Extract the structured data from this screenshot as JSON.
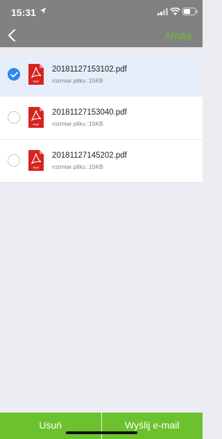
{
  "status_bar": {
    "time": "15:31"
  },
  "nav": {
    "back_icon": "chevron-left-icon",
    "cancel_label": "Anuluj",
    "accent_color": "#6cc12e"
  },
  "files": [
    {
      "name": "20181127153102.pdf",
      "size": "rozmiar pliku :15KB",
      "selected": true
    },
    {
      "name": "20181127153040.pdf",
      "size": "rozmiar pliku :15KB",
      "selected": false
    },
    {
      "name": "20181127145202.pdf",
      "size": "rozmiar pliku :15KB",
      "selected": false
    }
  ],
  "pdf_icon": {
    "label": "PDF",
    "color": "#d7231f"
  },
  "bottom_bar": {
    "delete_label": "Usuń",
    "send_label": "Wyślij e-mail"
  }
}
